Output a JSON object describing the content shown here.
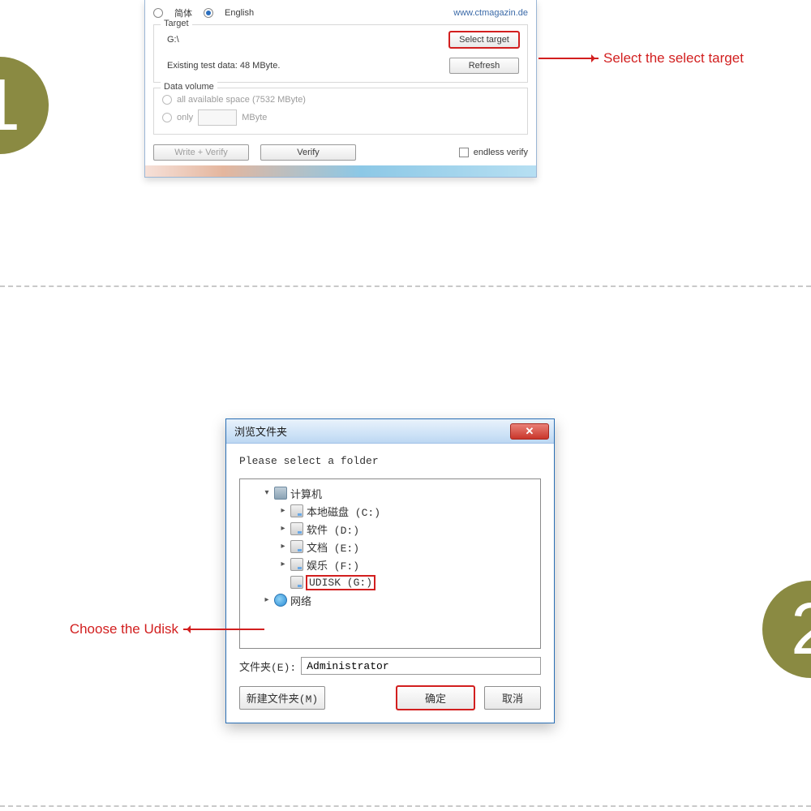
{
  "badges": {
    "step1": "1",
    "step2": "2"
  },
  "anno": {
    "selectTarget": "Select the select target",
    "chooseUdisk": "Choose the Udisk"
  },
  "h2w": {
    "lang": {
      "opt1": "简体",
      "opt2": "English"
    },
    "website": "www.ctmagazin.de",
    "targetGroup": "Target",
    "targetPath": "G:\\",
    "btnSelectTarget": "Select target",
    "existingLabel": "Existing test data: 48 MByte.",
    "btnRefresh": "Refresh",
    "dataVolumeGroup": "Data volume",
    "dvAll": "all available space (7532 MByte)",
    "dvOnly": "only",
    "dvUnit": "MByte",
    "btnWriteVerify": "Write + Verify",
    "btnVerify": "Verify",
    "endless": "endless verify"
  },
  "browse": {
    "title": "浏览文件夹",
    "prompt": "Please select a folder",
    "tree": {
      "computer": "计算机",
      "c": "本地磁盘 (C:)",
      "d": "软件 (D:)",
      "e": "文档 (E:)",
      "f": "娱乐 (F:)",
      "g": "UDISK (G:)",
      "network": "网络"
    },
    "folderLabel": "文件夹(E):",
    "folderValue": "Administrator",
    "btnNewFolder": "新建文件夹(M)",
    "btnOk": "确定",
    "btnCancel": "取消"
  }
}
